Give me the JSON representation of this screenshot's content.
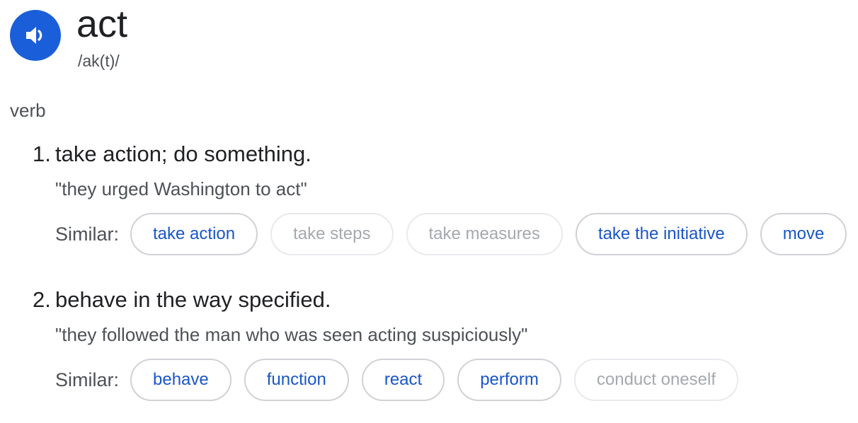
{
  "entry": {
    "word": "act",
    "phonetic": "/ak(t)/",
    "audio_icon": "speaker-icon",
    "part_of_speech": "verb"
  },
  "senses": [
    {
      "number": "1.",
      "definition": "take action; do something.",
      "example": "\"they urged Washington to act\"",
      "similar_label": "Similar:",
      "similar": [
        {
          "label": "take action",
          "enabled": true
        },
        {
          "label": "take steps",
          "enabled": false
        },
        {
          "label": "take measures",
          "enabled": false
        },
        {
          "label": "take the initiative",
          "enabled": true
        },
        {
          "label": "move",
          "enabled": true
        }
      ]
    },
    {
      "number": "2.",
      "definition": "behave in the way specified.",
      "example": "\"they followed the man who was seen acting suspiciously\"",
      "similar_label": "Similar:",
      "similar": [
        {
          "label": "behave",
          "enabled": true
        },
        {
          "label": "function",
          "enabled": true
        },
        {
          "label": "react",
          "enabled": true
        },
        {
          "label": "perform",
          "enabled": true
        },
        {
          "label": "conduct oneself",
          "enabled": false
        }
      ]
    }
  ],
  "colors": {
    "accent": "#1a5fd9",
    "link": "#1a56c7",
    "muted": "#a5a9ad",
    "text": "#202124",
    "secondary_text": "#4d5156"
  }
}
